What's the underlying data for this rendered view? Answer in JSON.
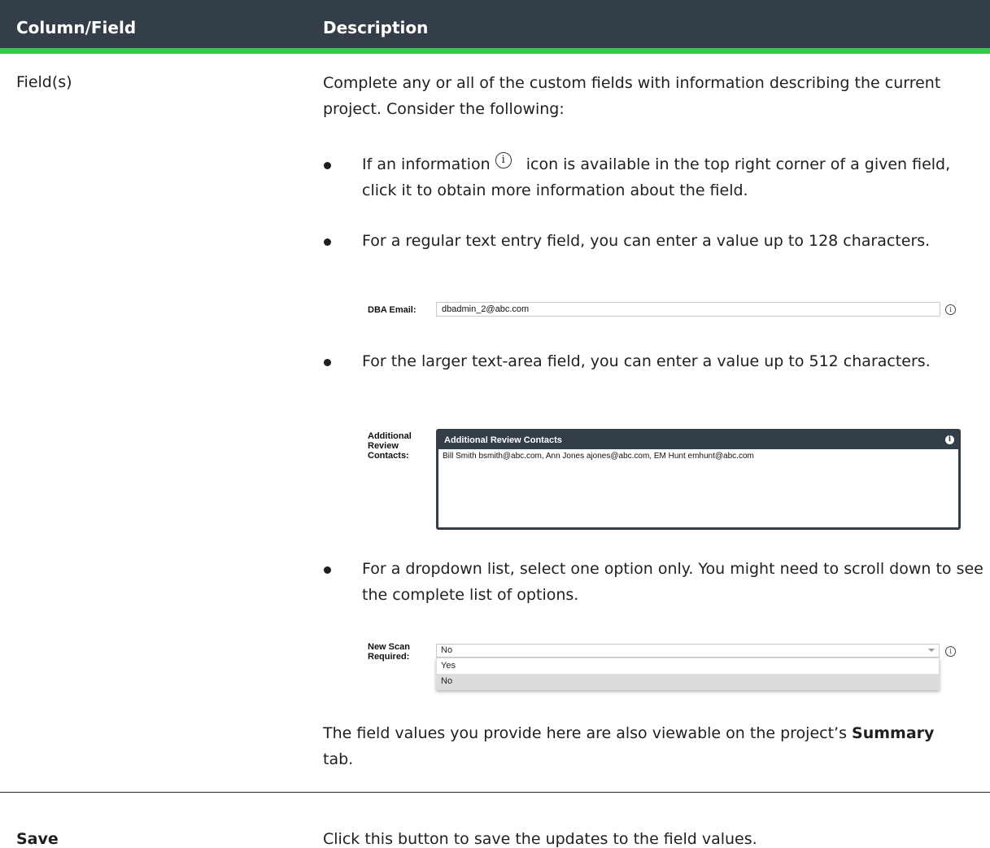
{
  "table": {
    "headers": {
      "field": "Column/Field",
      "description": "Description"
    },
    "rows": [
      {
        "field": "Field(s)",
        "intro": "Complete any or all of the custom fields with information describing the current project. Consider the following:",
        "bullets": [
          {
            "before_icon": "If an information",
            "after_icon": "icon is available in the top right corner of a given field, click it to obtain more information about the field."
          },
          {
            "text": "For a regular text entry field, you can enter a value up to 128 characters."
          },
          {
            "text": "For the larger text-area field, you can enter a value up to 512 characters."
          },
          {
            "text": "For a dropdown list, select one option only. You might need to scroll down to see the complete list of options."
          }
        ],
        "closing_text": "The field values you provide here are also viewable on the project’s",
        "closing_bold": "Summary",
        "closing_tail": " tab."
      },
      {
        "field": "Save",
        "description": "Click this button to save the updates to the field values."
      }
    ]
  },
  "examples": {
    "text_entry": {
      "label": "DBA Email:",
      "value": "dbadmin_2@abc.com"
    },
    "textarea": {
      "label_lines": [
        "Additional",
        "Review",
        "Contacts:"
      ],
      "title": "Additional Review Contacts",
      "value": "Bill Smith bsmith@abc.com, Ann Jones ajones@abc.com, EM Hunt emhunt@abc.com"
    },
    "dropdown": {
      "label_lines": [
        "New Scan",
        "Required:"
      ],
      "selected": "No",
      "options": [
        "Yes",
        "No"
      ]
    }
  },
  "icons": {
    "info": "info-circle-icon"
  },
  "colors": {
    "header_bg": "#343e48",
    "header_accent": "#3ac64a"
  }
}
